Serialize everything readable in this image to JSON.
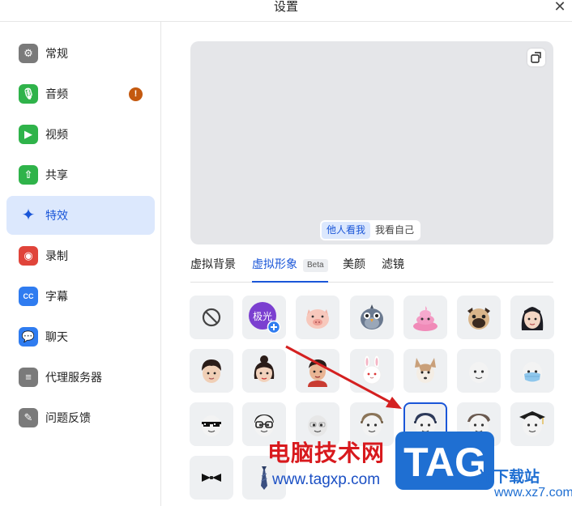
{
  "window": {
    "title": "设置"
  },
  "sidebar": {
    "items": [
      {
        "label": "常规",
        "icon": "gear-icon",
        "color": "#7a7a7a",
        "glyph": "⚙"
      },
      {
        "label": "音频",
        "icon": "microphone-icon",
        "color": "#2fb34a",
        "glyph": "🎙",
        "badge": "!"
      },
      {
        "label": "视频",
        "icon": "video-camera-icon",
        "color": "#2fb34a",
        "glyph": "▶"
      },
      {
        "label": "共享",
        "icon": "screen-share-icon",
        "color": "#2fb34a",
        "glyph": "⇧"
      },
      {
        "label": "特效",
        "icon": "sparkle-icon",
        "color": "#1a56d8",
        "glyph": "✦",
        "active": true
      },
      {
        "label": "录制",
        "icon": "record-icon",
        "color": "#e0443a",
        "glyph": "◉"
      },
      {
        "label": "字幕",
        "icon": "caption-icon",
        "color": "#2f7cf0",
        "glyph": "CC"
      },
      {
        "label": "聊天",
        "icon": "chat-bubble-icon",
        "color": "#2f7cf0",
        "glyph": "💬"
      },
      {
        "label": "代理服务器",
        "icon": "server-icon",
        "color": "#7a7a7a",
        "glyph": "≡"
      },
      {
        "label": "问题反馈",
        "icon": "feedback-icon",
        "color": "#7a7a7a",
        "glyph": "✎"
      }
    ]
  },
  "preview": {
    "view_options": [
      {
        "label": "他人看我",
        "active": true
      },
      {
        "label": "我看自己",
        "active": false
      }
    ],
    "rotate_icon": "rotate-icon"
  },
  "tabs": [
    {
      "label": "虚拟背景",
      "active": false
    },
    {
      "label": "虚拟形象",
      "active": true,
      "badge": "Beta"
    },
    {
      "label": "美颜",
      "active": false
    },
    {
      "label": "滤镜",
      "active": false
    }
  ],
  "avatar_grid": {
    "selected_index": 18,
    "items": [
      "none-icon",
      "jiguang-add-avatar",
      "pig-avatar",
      "bird-avatar",
      "pink-poop-avatar",
      "pug-dog-avatar",
      "girl-long-hair-avatar",
      "boy-avatar",
      "girl-bun-avatar",
      "boy-red-shirt-avatar",
      "rabbit-avatar",
      "husky-dog-avatar",
      "plain-face-avatar",
      "face-mask-avatar",
      "pixel-sunglasses-avatar",
      "glasses-avatar",
      "bald-avatar",
      "brown-cap-avatar",
      "navy-cap-avatar",
      "flat-cap-avatar",
      "graduation-cap-avatar",
      "bow-tie-avatar",
      "necktie-avatar"
    ],
    "jiguang_label": "极光"
  },
  "watermark": {
    "site_name": "电脑技术网",
    "site_url": "www.tagxp.com",
    "logo_text": "TAG",
    "partner_text": "光下载站",
    "partner_url": "www.xz7.com"
  },
  "colors": {
    "accent": "#1a56d8",
    "active_bg": "#dce8fd",
    "badge": "#c4590f",
    "arrow": "#d42020"
  }
}
